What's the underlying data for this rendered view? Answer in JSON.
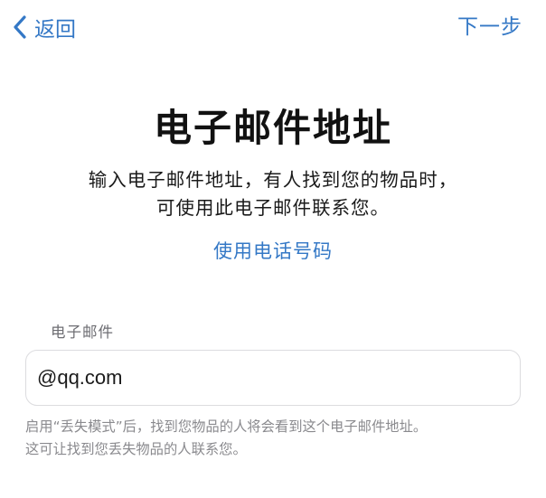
{
  "nav": {
    "back_label": "返回",
    "next_label": "下一步",
    "back_icon": "chevron-left-icon",
    "accent_color": "#3478c6"
  },
  "main": {
    "title": "电子邮件地址",
    "description_line1": "输入电子邮件地址，有人找到您的物品时，",
    "description_line2": "可使用此电子邮件联系您。",
    "phone_link": "使用电话号码"
  },
  "email_field": {
    "label": "电子邮件",
    "value": "@qq.com",
    "placeholder": ""
  },
  "helper": {
    "line1": "启用“丢失模式”后，找到您物品的人将会看到这个电子邮件地址。",
    "line2": "这可让找到您丢失物品的人联系您。"
  }
}
